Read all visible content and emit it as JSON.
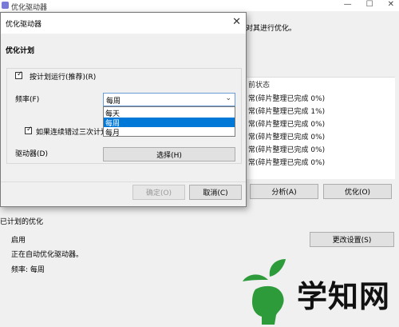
{
  "background_window": {
    "title": "优化驱动器",
    "description_fragment": "对其进行优化。",
    "list_header": "前状态",
    "drive_rows": [
      "常(碎片整理已完成 0%)",
      "常(碎片整理已完成 1%)",
      "常(碎片整理已完成 0%)",
      "常(碎片整理已完成 0%)",
      "常(碎片整理已完成 0%)",
      "常(碎片整理已完成 0%)"
    ],
    "analyze_label": "分析(A)",
    "optimize_label": "优化(O)",
    "scheduled_label": "已计划的优化",
    "scheduled_status": "启用",
    "scheduled_desc": "正在自动优化驱动器。",
    "scheduled_freq": "频率: 每周",
    "change_settings_label": "更改设置(S)"
  },
  "dialog": {
    "title": "优化驱动器",
    "plan_heading": "优化计划",
    "run_on_schedule_label": "按计划运行(推荐)(R)",
    "frequency_label": "频率(F)",
    "frequency_value": "每周",
    "frequency_options": [
      "每天",
      "每周",
      "每月"
    ],
    "notify_label": "如果连续错过三次计划",
    "drives_label": "驱动器(D)",
    "choose_label": "选择(H)",
    "ok_label": "确定(O)",
    "cancel_label": "取消(C)"
  },
  "watermark": {
    "text": "学知网",
    "accent_color": "#2e9b3b"
  }
}
